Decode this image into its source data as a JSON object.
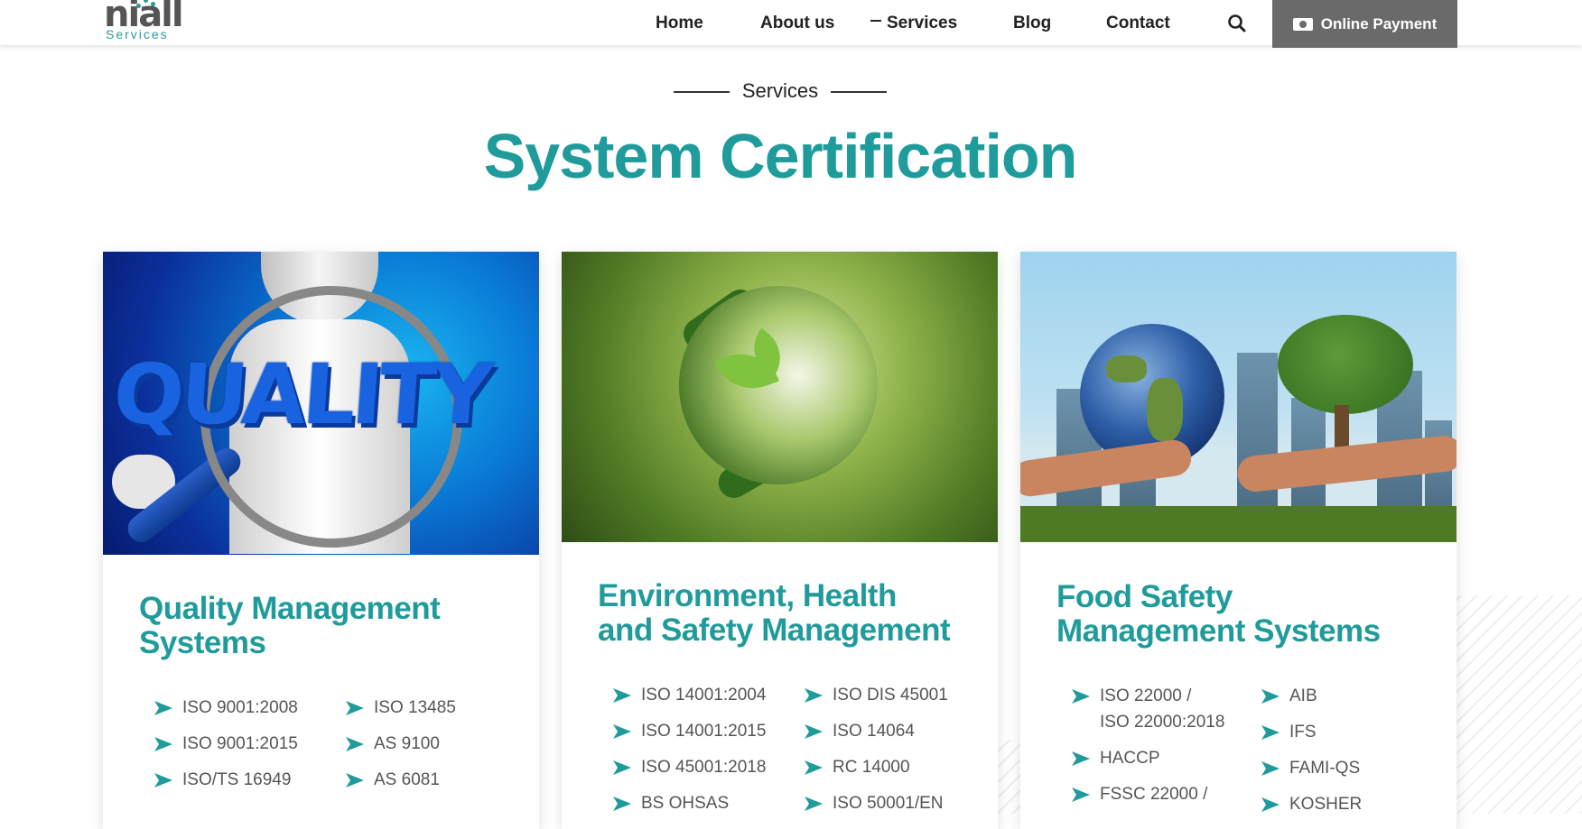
{
  "header": {
    "logo_word": "niall",
    "logo_sub": "Services",
    "nav": [
      "Home",
      "About us",
      "Services",
      "Blog",
      "Contact"
    ],
    "active_nav": "Services",
    "payment_label": "Online Payment"
  },
  "section": {
    "eyebrow": "Services",
    "title": "System Certification"
  },
  "cards": [
    {
      "title_line1": "Quality Management",
      "title_line2": "Systems",
      "image": "quality-magnifier-image",
      "col1": [
        "ISO 9001:2008",
        "ISO 9001:2015",
        "ISO/TS 16949"
      ],
      "col2": [
        "ISO 13485",
        "AS 9100",
        "AS 6081"
      ]
    },
    {
      "title_line1": "Environment, Health",
      "title_line2": "and Safety Management",
      "image": "green-globe-recycle-image",
      "col1": [
        "ISO 14001:2004",
        "ISO 14001:2015",
        "ISO 45001:2018",
        "BS OHSAS"
      ],
      "col2": [
        "ISO DIS 45001",
        "ISO 14064",
        "RC 14000",
        "ISO 50001/EN"
      ]
    },
    {
      "title_line1": "Food Safety",
      "title_line2": "Management Systems",
      "image": "earth-tree-hands-image",
      "col1": [
        "ISO 22000 /",
        "ISO 22000:2018",
        "HACCP",
        "FSSC 22000 /"
      ],
      "col2": [
        "AIB",
        "IFS",
        "FAMI-QS",
        "KOSHER"
      ]
    }
  ],
  "colors": {
    "accent": "#1f9b9b",
    "payment_button": "#6a6a6a",
    "text": "#555555"
  }
}
